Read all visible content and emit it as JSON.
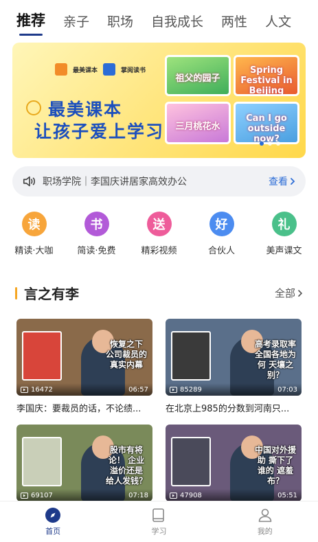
{
  "tabs": [
    {
      "label": "推荐",
      "active": true
    },
    {
      "label": "亲子"
    },
    {
      "label": "职场"
    },
    {
      "label": "自我成长"
    },
    {
      "label": "两性"
    },
    {
      "label": "人文"
    }
  ],
  "banner": {
    "logo_left": "最美课本",
    "logo_right": "掌阅读书",
    "title_line1": "最美课本",
    "title_line2": "让孩子爱上学习",
    "cards": [
      "祖父的园子",
      "Spring Festival in Beijing",
      "三月桃花水",
      "Can I go outside now?"
    ]
  },
  "notice": {
    "text": "职场学院｜李国庆讲居家高效办公",
    "link": "查看"
  },
  "quick_links": [
    {
      "icon": "读",
      "label": "精读·大咖",
      "color": "#f7a53b"
    },
    {
      "icon": "书",
      "label": "简读·免费",
      "color": "#b25ad8"
    },
    {
      "icon": "送",
      "label": "精彩视频",
      "color": "#ee5c9a"
    },
    {
      "icon": "好",
      "label": "合伙人",
      "color": "#4c8cf0"
    },
    {
      "icon": "礼",
      "label": "美声课文",
      "color": "#4ac08a"
    }
  ],
  "section": {
    "title": "言之有李",
    "all_label": "全部"
  },
  "videos": [
    {
      "caption": "恢复之下 公司裁员的 真实内幕",
      "views": "16472",
      "duration": "06:57",
      "title": "李国庆：要裁员的话，不论绩...",
      "bg": "#8a6a4a"
    },
    {
      "caption": "高考录取率 全国各地为何 天壤之别？",
      "views": "85289",
      "duration": "07:03",
      "title": "在北京上985的分数到河南只...",
      "bg": "#5a6f8a"
    },
    {
      "caption": "股市有将论！ 企业溢价还是 给人发钱？",
      "views": "69107",
      "duration": "07:18",
      "title": "",
      "bg": "#7a8a5a"
    },
    {
      "caption": "中国对外援助 撕下了谁的 遮羞布？",
      "views": "47908",
      "duration": "05:51",
      "title": "",
      "bg": "#6a5a7a"
    }
  ],
  "bottom_nav": [
    {
      "label": "首页",
      "active": true
    },
    {
      "label": "学习"
    },
    {
      "label": "我的"
    }
  ],
  "colors": {
    "accent": "#1e3a8a",
    "link": "#2b6cd6",
    "section_bar": "#f5a623"
  }
}
